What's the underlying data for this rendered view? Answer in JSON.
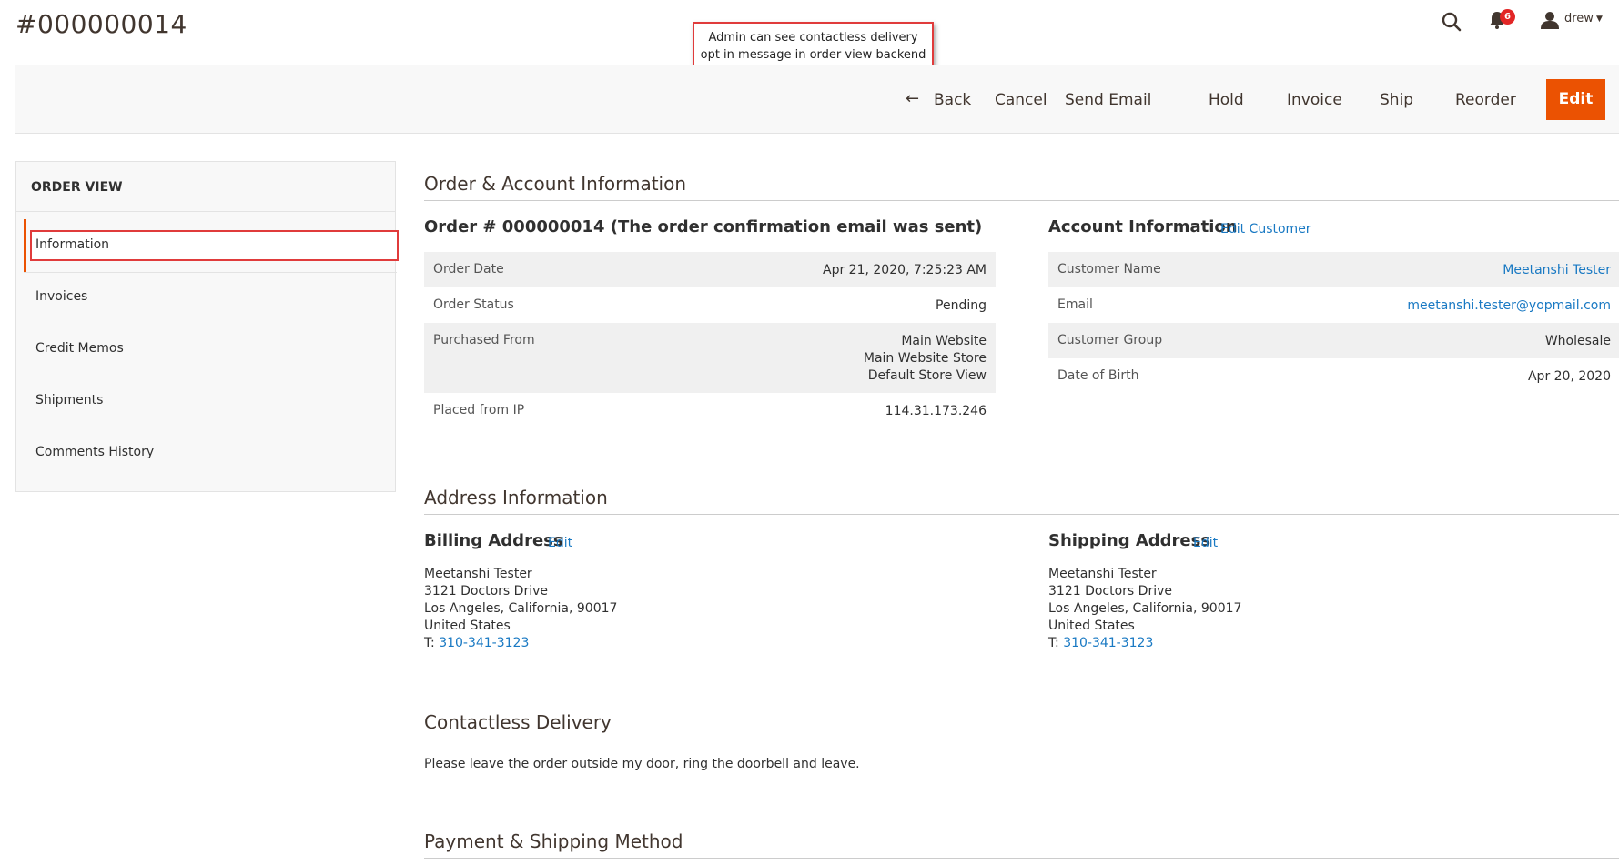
{
  "page": {
    "title": "#000000014"
  },
  "callout": {
    "line1": "Admin can see contactless delivery",
    "line2": "opt in message in order view backend"
  },
  "header": {
    "notification_count": "6",
    "user_name": "drew"
  },
  "toolbar": {
    "back_label": "Back",
    "cancel_label": "Cancel",
    "send_email_label": "Send Email",
    "hold_label": "Hold",
    "invoice_label": "Invoice",
    "ship_label": "Ship",
    "reorder_label": "Reorder",
    "edit_label": "Edit"
  },
  "sidebar": {
    "title": "ORDER VIEW",
    "items": [
      {
        "label": "Information"
      },
      {
        "label": "Invoices"
      },
      {
        "label": "Credit Memos"
      },
      {
        "label": "Shipments"
      },
      {
        "label": "Comments History"
      }
    ]
  },
  "order_account": {
    "section_title": "Order & Account Information",
    "order_heading": "Order # 000000014 (The order confirmation email was sent)",
    "order_rows": [
      {
        "label": "Order Date",
        "value": "Apr 21, 2020, 7:25:23 AM"
      },
      {
        "label": "Order Status",
        "value": "Pending"
      },
      {
        "label": "Purchased From",
        "value_lines": [
          "Main Website",
          "Main Website Store",
          "Default Store View"
        ]
      },
      {
        "label": "Placed from IP",
        "value": "114.31.173.246"
      }
    ],
    "account_heading": "Account Information",
    "edit_customer_label": "Edit Customer",
    "account_rows": [
      {
        "label": "Customer Name",
        "value": "Meetanshi Tester"
      },
      {
        "label": "Email",
        "value": "meetanshi.tester@yopmail.com"
      },
      {
        "label": "Customer Group",
        "value": "Wholesale"
      },
      {
        "label": "Date of Birth",
        "value": "Apr 20, 2020"
      }
    ]
  },
  "address": {
    "section_title": "Address Information",
    "billing_heading": "Billing Address",
    "shipping_heading": "Shipping Address",
    "edit_label": "Edit",
    "billing": {
      "name": "Meetanshi Tester",
      "street": "3121 Doctors Drive",
      "city": "Los Angeles, California, 90017",
      "country": "United States",
      "phone_prefix": "T: ",
      "phone": "310-341-3123"
    },
    "shipping": {
      "name": "Meetanshi Tester",
      "street": "3121 Doctors Drive",
      "city": "Los Angeles, California, 90017",
      "country": "United States",
      "phone_prefix": "T: ",
      "phone": "310-341-3123"
    }
  },
  "contactless": {
    "section_title": "Contactless Delivery",
    "message": "Please leave the order outside my door, ring the doorbell and leave."
  },
  "payment": {
    "section_title": "Payment & Shipping Method"
  },
  "colors": {
    "accent": "#eb5202",
    "link": "#1979c3",
    "highlight": "#e03b3b"
  }
}
